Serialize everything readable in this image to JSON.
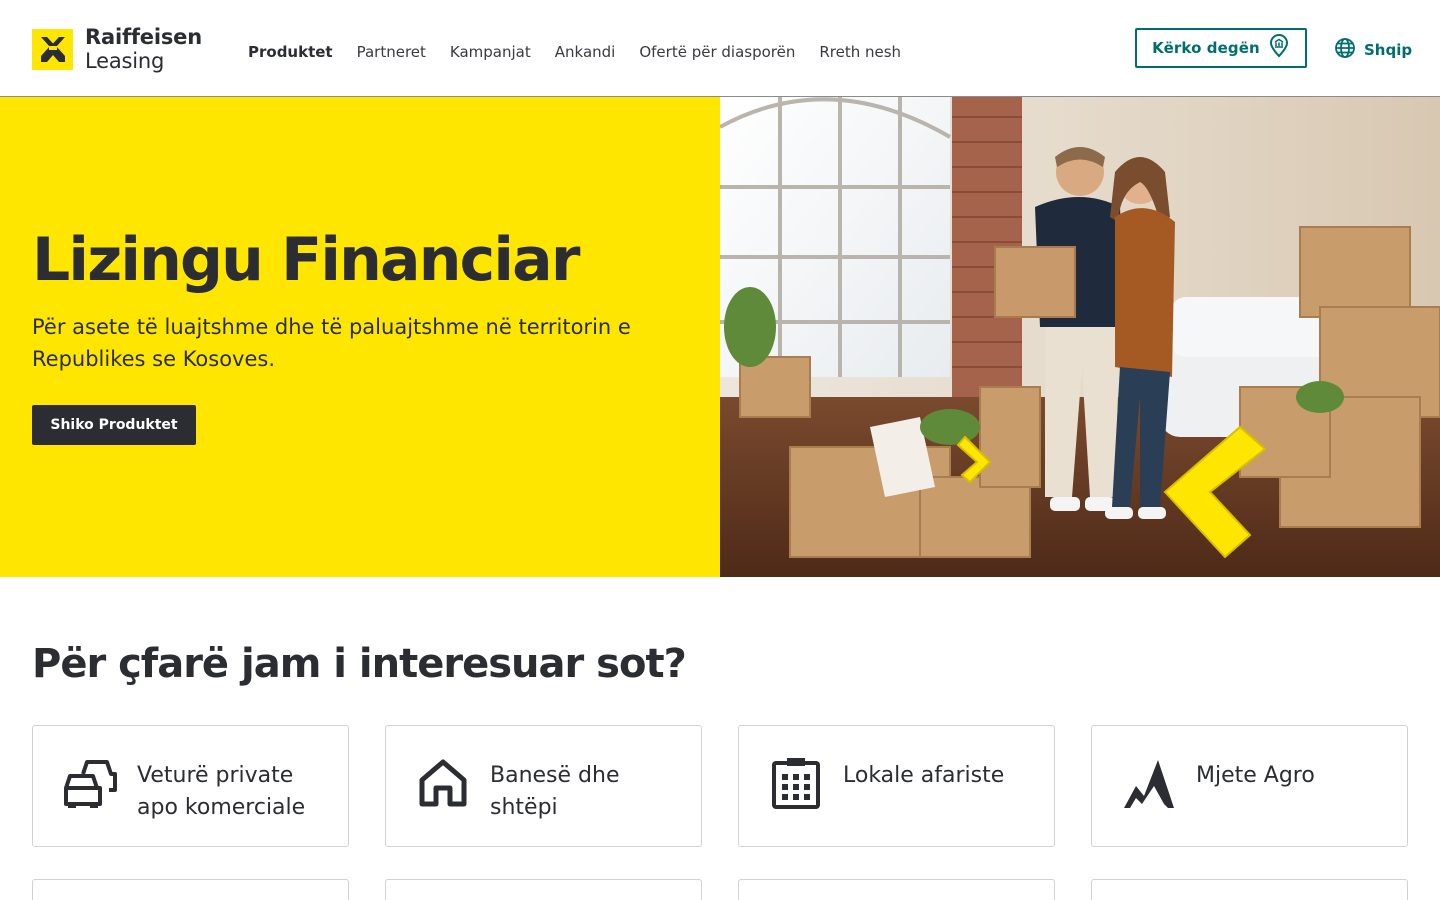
{
  "brand": {
    "logo_line1": "Raiffeisen",
    "logo_line2": "Leasing",
    "yellow": "#ffe600",
    "teal": "#006e6e",
    "dark": "#2b2d33"
  },
  "nav": {
    "items": [
      {
        "label": "Produktet",
        "active": true
      },
      {
        "label": "Partneret"
      },
      {
        "label": "Kampanjat"
      },
      {
        "label": "Ankandi"
      },
      {
        "label": "Ofertë për diasporën"
      },
      {
        "label": "Rreth nesh"
      }
    ],
    "branch_label": "Kërko degën",
    "language_label": "Shqip"
  },
  "hero": {
    "title": "Lizingu Financiar",
    "subtitle": "Për asete të luajtshme dhe të paluajtshme në territorin e Republikes se Kosoves.",
    "cta": "Shiko Produktet"
  },
  "section": {
    "title": "Për çfarë jam i interesuar sot?"
  },
  "cards": [
    {
      "label": "Veturë private apo komerciale",
      "icon": "cars-icon"
    },
    {
      "label": "Banesë dhe shtëpi",
      "icon": "house-icon"
    },
    {
      "label": "Lokale afariste",
      "icon": "office-building-icon"
    },
    {
      "label": "Mjete Agro",
      "icon": "agro-field-icon"
    }
  ]
}
